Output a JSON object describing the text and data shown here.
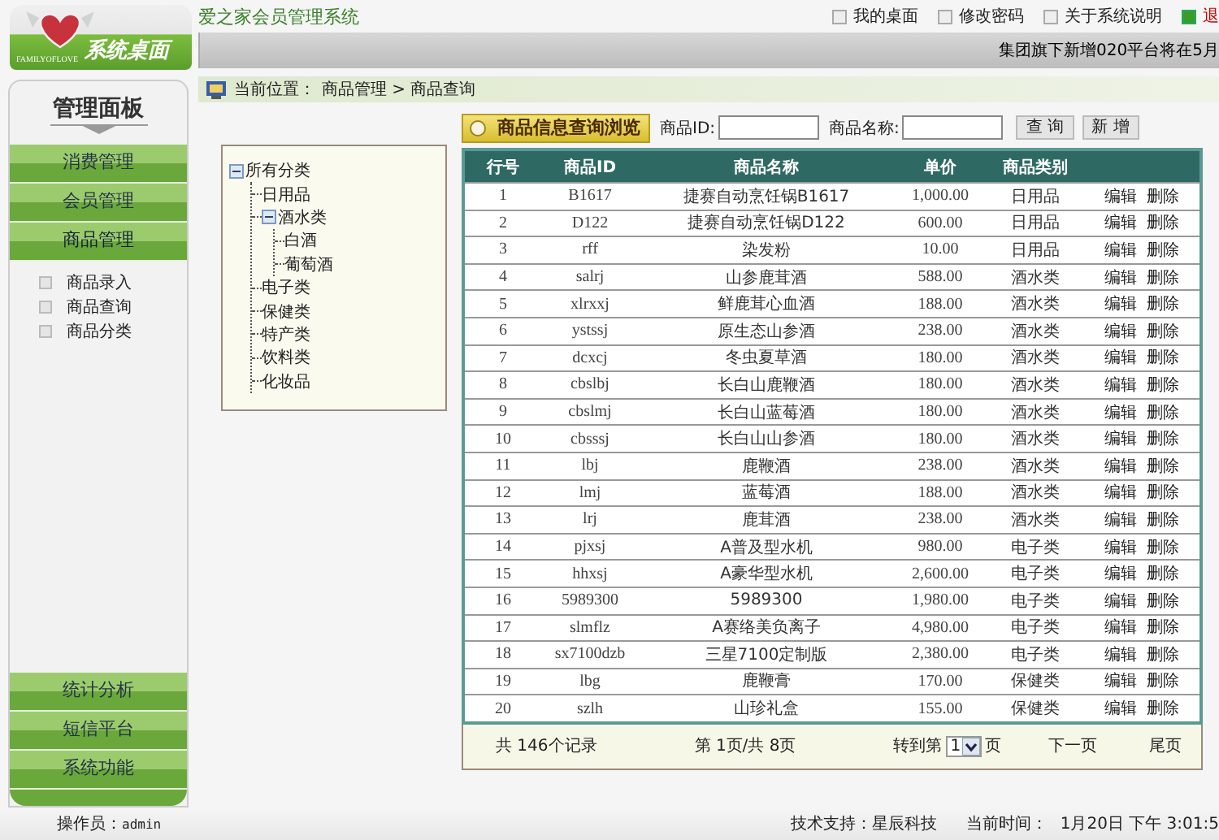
{
  "app": {
    "logo_title": "系统桌面",
    "logo_subtitle": "FAMILYOFLOVE",
    "title": "爱之家会员管理系统"
  },
  "top_links": [
    {
      "label": "我的桌面",
      "kind": "link"
    },
    {
      "label": "修改密码",
      "kind": "link"
    },
    {
      "label": "关于系统说明",
      "kind": "link"
    },
    {
      "label": "退",
      "kind": "exit"
    }
  ],
  "marquee": "集团旗下新增020平台将在5月",
  "sidebar": {
    "title": "管理面板",
    "menu": [
      {
        "label": "消费管理",
        "expanded": false
      },
      {
        "label": "会员管理",
        "expanded": false
      },
      {
        "label": "商品管理",
        "expanded": true,
        "children": [
          "商品录入",
          "商品查询",
          "商品分类"
        ]
      }
    ],
    "bottom_menu": [
      "统计分析",
      "短信平台",
      "系统功能"
    ]
  },
  "breadcrumb": {
    "label": "当前位置：",
    "path": "商品管理 > 商品查询"
  },
  "tree": {
    "label": "所有分类",
    "expanded": true,
    "children": [
      {
        "label": "日用品"
      },
      {
        "label": "酒水类",
        "expanded": true,
        "children": [
          {
            "label": "白酒"
          },
          {
            "label": "葡萄酒"
          }
        ]
      },
      {
        "label": "电子类"
      },
      {
        "label": "保健类"
      },
      {
        "label": "特产类"
      },
      {
        "label": "饮料类"
      },
      {
        "label": "化妆品"
      }
    ]
  },
  "query": {
    "title": "商品信息查询浏览",
    "fields": [
      {
        "label": "商品ID:"
      },
      {
        "label": "商品名称:"
      }
    ],
    "buttons": [
      "查 询",
      "新 增"
    ]
  },
  "table": {
    "columns": [
      "行号",
      "商品ID",
      "商品名称",
      "单价",
      "商品类别"
    ],
    "rows": [
      {
        "cells": [
          "1",
          "B1617",
          "捷赛自动烹饪锅B1617",
          "1,000.00",
          "日用品"
        ],
        "actions": [
          "编辑",
          "删除"
        ]
      },
      {
        "cells": [
          "2",
          "D122",
          "捷赛自动烹饪锅D122",
          "600.00",
          "日用品"
        ],
        "actions": [
          "编辑",
          "删除"
        ]
      },
      {
        "cells": [
          "3",
          "rff",
          "染发粉",
          "10.00",
          "日用品"
        ],
        "actions": [
          "编辑",
          "删除"
        ]
      },
      {
        "cells": [
          "4",
          "salrj",
          "山参鹿茸酒",
          "588.00",
          "酒水类"
        ],
        "actions": [
          "编辑",
          "删除"
        ]
      },
      {
        "cells": [
          "5",
          "xlrxxj",
          "鲜鹿茸心血酒",
          "188.00",
          "酒水类"
        ],
        "actions": [
          "编辑",
          "删除"
        ]
      },
      {
        "cells": [
          "6",
          "ystssj",
          "原生态山参酒",
          "238.00",
          "酒水类"
        ],
        "actions": [
          "编辑",
          "删除"
        ]
      },
      {
        "cells": [
          "7",
          "dcxcj",
          "冬虫夏草酒",
          "180.00",
          "酒水类"
        ],
        "actions": [
          "编辑",
          "删除"
        ]
      },
      {
        "cells": [
          "8",
          "cbslbj",
          "长白山鹿鞭酒",
          "180.00",
          "酒水类"
        ],
        "actions": [
          "编辑",
          "删除"
        ]
      },
      {
        "cells": [
          "9",
          "cbslmj",
          "长白山蓝莓酒",
          "180.00",
          "酒水类"
        ],
        "actions": [
          "编辑",
          "删除"
        ]
      },
      {
        "cells": [
          "10",
          "cbsssj",
          "长白山山参酒",
          "180.00",
          "酒水类"
        ],
        "actions": [
          "编辑",
          "删除"
        ]
      },
      {
        "cells": [
          "11",
          "lbj",
          "鹿鞭酒",
          "238.00",
          "酒水类"
        ],
        "actions": [
          "编辑",
          "删除"
        ]
      },
      {
        "cells": [
          "12",
          "lmj",
          "蓝莓酒",
          "188.00",
          "酒水类"
        ],
        "actions": [
          "编辑",
          "删除"
        ]
      },
      {
        "cells": [
          "13",
          "lrj",
          "鹿茸酒",
          "238.00",
          "酒水类"
        ],
        "actions": [
          "编辑",
          "删除"
        ]
      },
      {
        "cells": [
          "14",
          "pjxsj",
          "A普及型水机",
          "980.00",
          "电子类"
        ],
        "actions": [
          "编辑",
          "删除"
        ]
      },
      {
        "cells": [
          "15",
          "hhxsj",
          "A豪华型水机",
          "2,600.00",
          "电子类"
        ],
        "actions": [
          "编辑",
          "删除"
        ]
      },
      {
        "cells": [
          "16",
          "5989300",
          "5989300",
          "1,980.00",
          "电子类"
        ],
        "actions": [
          "编辑",
          "删除"
        ]
      },
      {
        "cells": [
          "17",
          "slmflz",
          "A赛络美负离子",
          "4,980.00",
          "电子类"
        ],
        "actions": [
          "编辑",
          "删除"
        ]
      },
      {
        "cells": [
          "18",
          "sx7100dzb",
          "三星7100定制版",
          "2,380.00",
          "电子类"
        ],
        "actions": [
          "编辑",
          "删除"
        ]
      },
      {
        "cells": [
          "19",
          "lbg",
          "鹿鞭膏",
          "170.00",
          "保健类"
        ],
        "actions": [
          "编辑",
          "删除"
        ]
      },
      {
        "cells": [
          "20",
          "szlh",
          "山珍礼盒",
          "155.00",
          "保健类"
        ],
        "actions": [
          "编辑",
          "删除"
        ]
      }
    ]
  },
  "pager": {
    "total": "共 146个记录",
    "page": "第 1页/共 8页",
    "goto_label": "转到第",
    "goto_value": "1",
    "goto_suffix": "页",
    "next": "下一页",
    "last": "尾页"
  },
  "footer": {
    "operator_label": "操作员：",
    "operator": "admin",
    "support": "技术支持：星辰科技",
    "time_label": "当前时间：",
    "time": "1月20日 下午 3:01:5"
  }
}
